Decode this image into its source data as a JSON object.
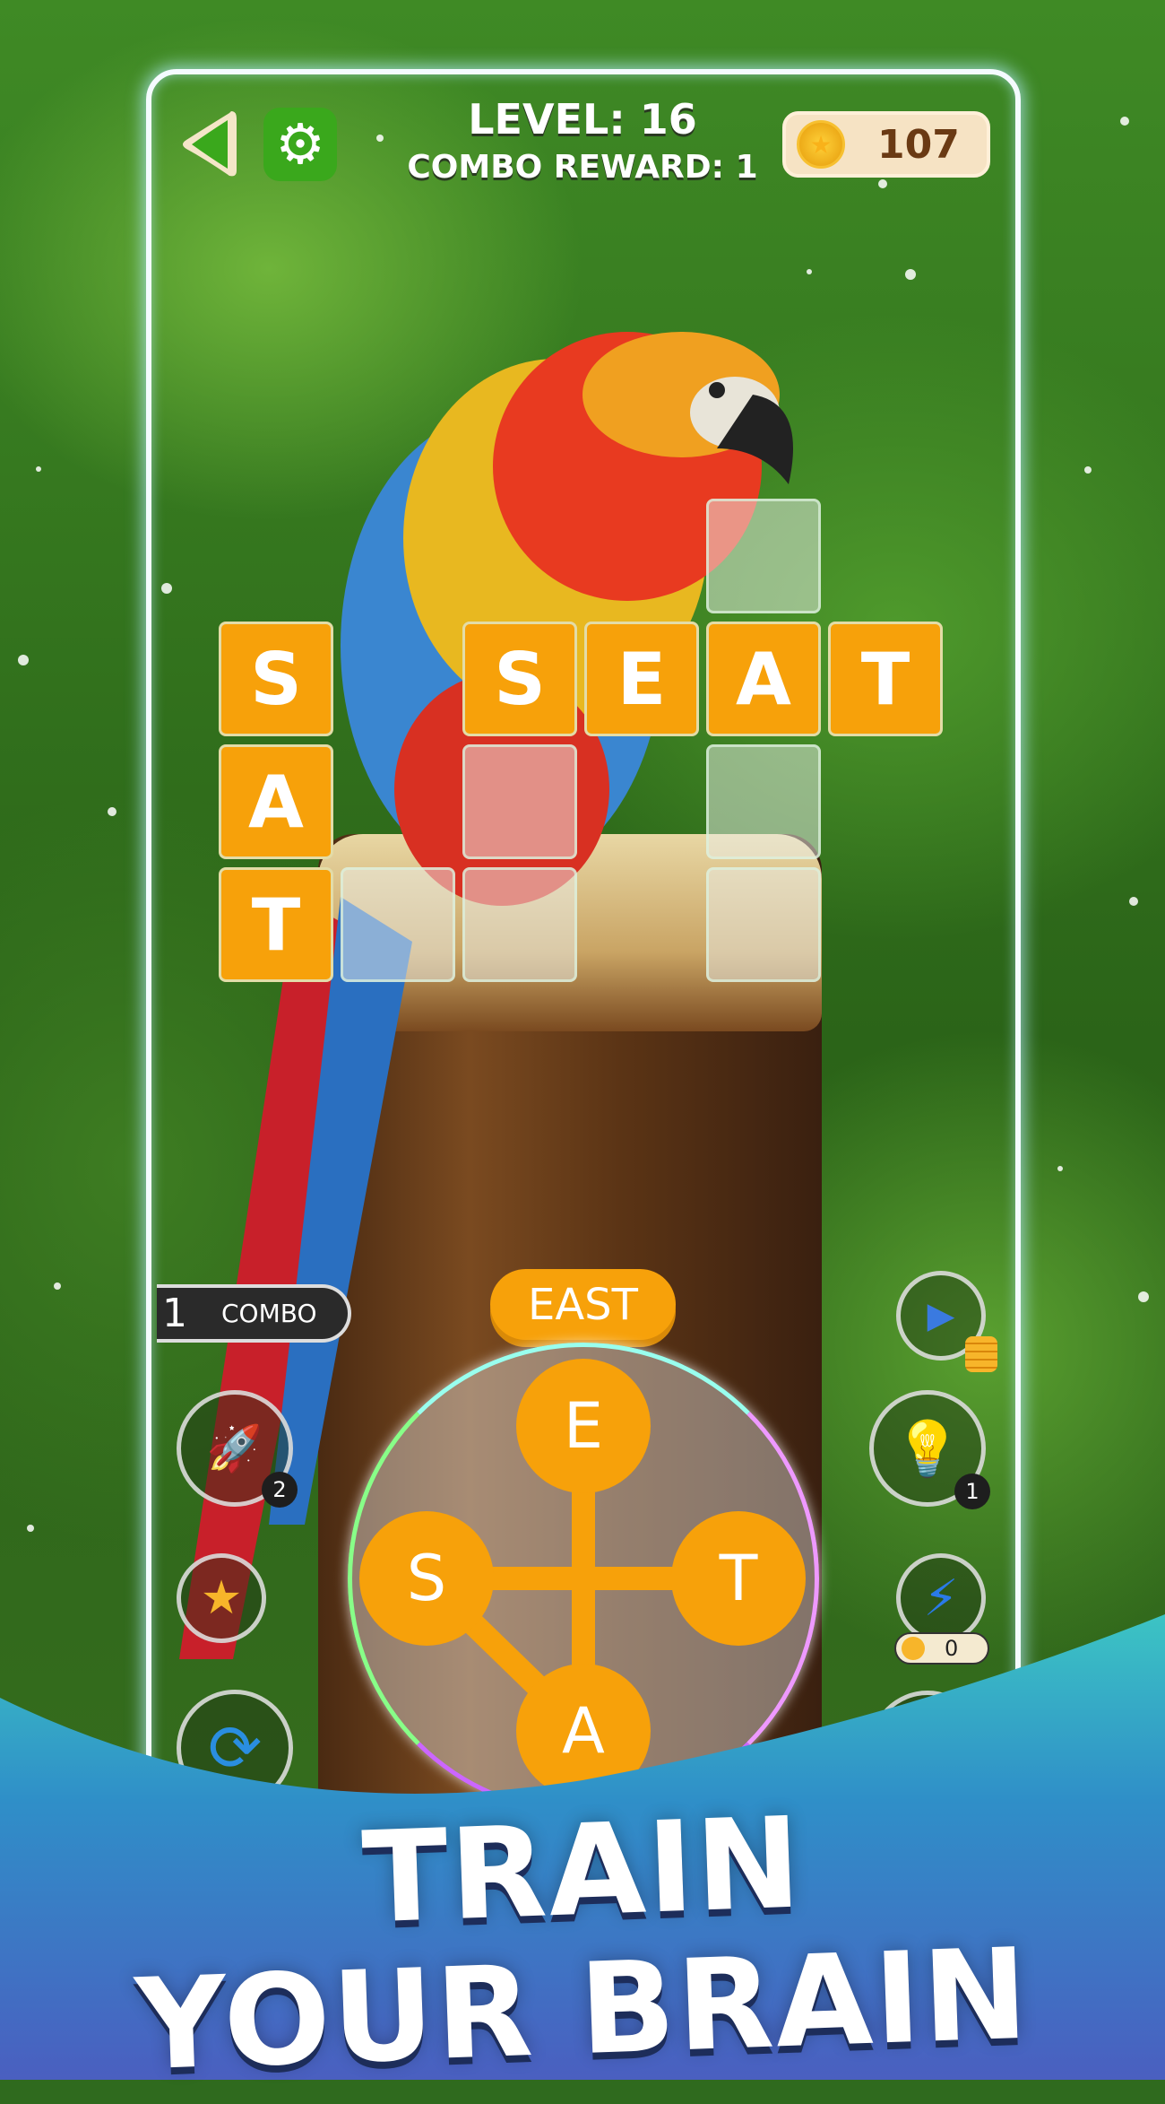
{
  "header": {
    "level_label": "LEVEL: 16",
    "combo_reward_label": "COMBO REWARD: 1",
    "coins": "107"
  },
  "grid": {
    "tiles": [
      {
        "row": 0,
        "col": 4,
        "letter": ""
      },
      {
        "row": 1,
        "col": 0,
        "letter": "S"
      },
      {
        "row": 1,
        "col": 2,
        "letter": "S"
      },
      {
        "row": 1,
        "col": 3,
        "letter": "E"
      },
      {
        "row": 1,
        "col": 4,
        "letter": "A"
      },
      {
        "row": 1,
        "col": 5,
        "letter": "T"
      },
      {
        "row": 2,
        "col": 0,
        "letter": "A"
      },
      {
        "row": 2,
        "col": 2,
        "letter": ""
      },
      {
        "row": 2,
        "col": 4,
        "letter": ""
      },
      {
        "row": 3,
        "col": 0,
        "letter": "T"
      },
      {
        "row": 3,
        "col": 1,
        "letter": ""
      },
      {
        "row": 3,
        "col": 2,
        "letter": ""
      },
      {
        "row": 3,
        "col": 4,
        "letter": ""
      }
    ]
  },
  "combo": {
    "count": "1",
    "label": "COMBO"
  },
  "current_word": "EAST",
  "wheel": {
    "letters": [
      "E",
      "S",
      "T",
      "A"
    ]
  },
  "powerups": {
    "rocket_count": "2",
    "hint_count": "1",
    "lightning_cost": "0"
  },
  "slogan": {
    "line1": "TRAIN",
    "line2": "YOUR BRAIN"
  },
  "colors": {
    "tile": "#f7a10a",
    "wave_top": "#3cc4c4",
    "wave_bottom": "#4a5fc0",
    "frame": "#f4fbff"
  },
  "icons": [
    "back-arrow-icon",
    "gear-icon",
    "coin-icon",
    "rocket-icon",
    "star-icon",
    "shuffle-icon",
    "video-coins-icon",
    "lightbulb-icon",
    "lightning-icon"
  ]
}
